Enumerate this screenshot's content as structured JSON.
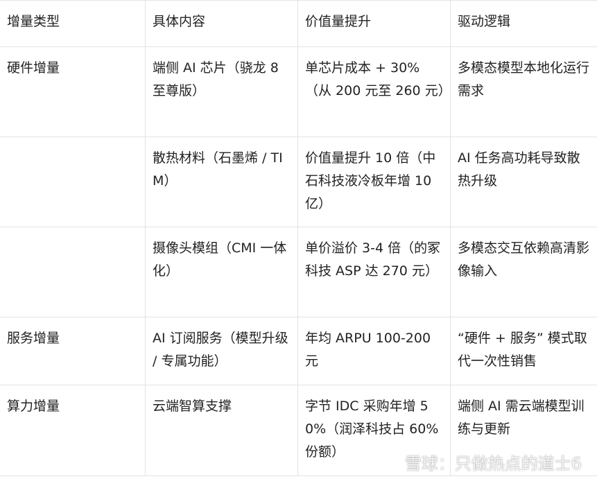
{
  "headers": [
    "增量类型",
    "具体内容",
    "价值量提升",
    "驱动逻辑"
  ],
  "rows": [
    {
      "type": "硬件增量",
      "content": "端侧 AI 芯片（骁龙 8 至尊版）",
      "value": "单芯片成本 + 30%（从 200 元至 260 元）",
      "logic": "多模态模型本地化运行需求"
    },
    {
      "type": "",
      "content": "散热材料（石墨烯 / TIM）",
      "value": "价值量提升 10 倍（中石科技液冷板年增 10 亿）",
      "logic": "AI 任务高功耗导致散热升级"
    },
    {
      "type": "",
      "content": "摄像头模组（CMI 一体化）",
      "value": "单价溢价 3-4 倍（的冢科技 ASP 达 270 元）",
      "logic": "多模态交互依赖高清影像输入"
    },
    {
      "type": "服务增量",
      "content": "AI 订阅服务（模型升级 / 专属功能）",
      "value": "年均 ARPU 100-200 元",
      "logic": "“硬件 + 服务” 模式取代一次性销售"
    },
    {
      "type": "算力增量",
      "content": "云端智算支撑",
      "value": "字节 IDC 采购年增 50%（润泽科技占 60% 份额）",
      "logic": "端侧 AI 需云端模型训练与更新"
    }
  ],
  "watermark": {
    "text": "雪球：只做热点的道士6",
    "icon": "snowball-logo-icon"
  }
}
